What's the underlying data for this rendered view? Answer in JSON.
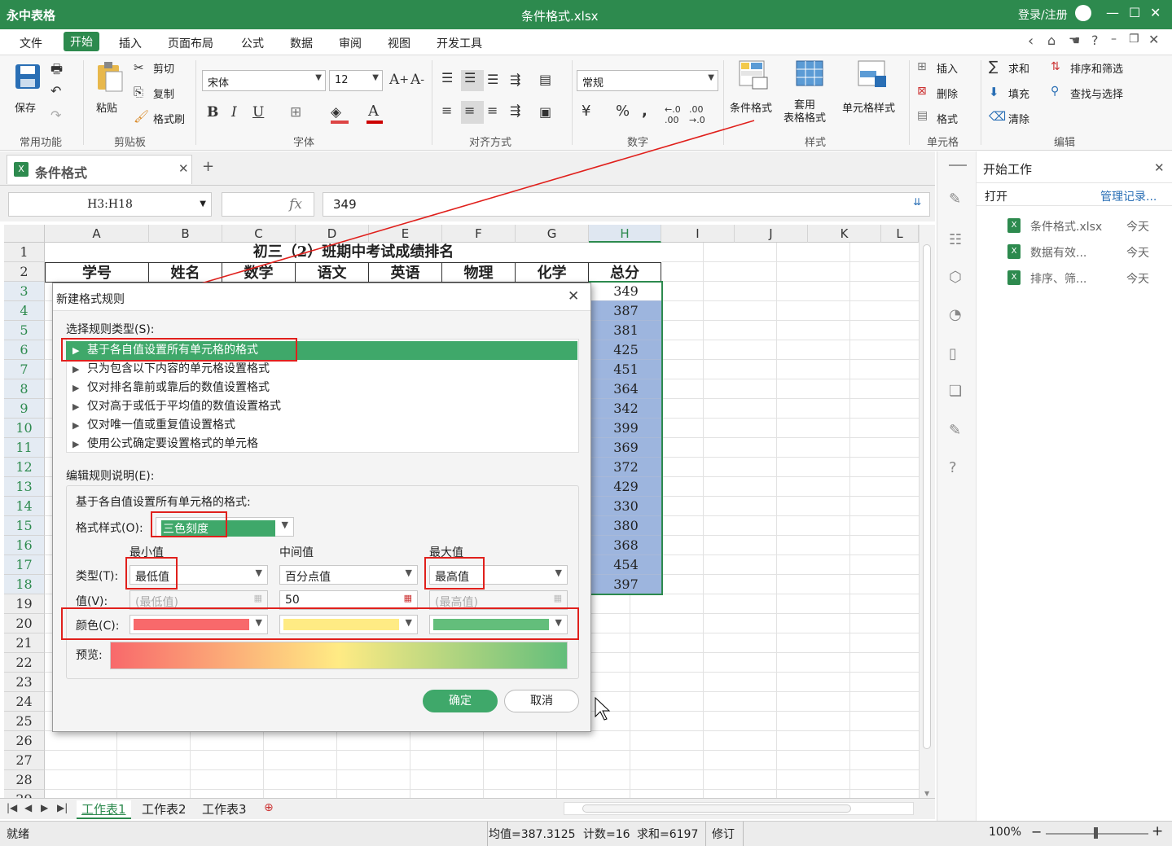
{
  "titlebar": {
    "app": "永中表格",
    "doc": "条件格式.xlsx",
    "login": "登录/注册"
  },
  "menus": [
    "文件",
    "开始",
    "插入",
    "页面布局",
    "公式",
    "数据",
    "审阅",
    "视图",
    "开发工具"
  ],
  "ribbon": {
    "save": "保存",
    "paste": "粘贴",
    "cut": "剪切",
    "copy": "复制",
    "format_painter": "格式刷",
    "font_name": "宋体",
    "font_size": "12",
    "number_format": "常规",
    "cond_format": "条件格式",
    "table_style": "套用\n表格格式",
    "cell_style": "单元格样式",
    "insert": "插入",
    "delete": "删除",
    "format": "格式",
    "sum": "求和",
    "fill": "填充",
    "clear": "清除",
    "sort_filter": "排序和筛选",
    "find_select": "查找与选择",
    "groups": [
      "常用功能",
      "剪贴板",
      "字体",
      "对齐方式",
      "数字",
      "样式",
      "单元格",
      "编辑"
    ]
  },
  "doc_tab": "条件格式",
  "formula": {
    "name_box": "H3:H18",
    "fx": "fx",
    "value": "349"
  },
  "columns": [
    "A",
    "B",
    "C",
    "D",
    "E",
    "F",
    "G",
    "H",
    "I",
    "J",
    "K"
  ],
  "rows": [
    "1",
    "2",
    "3",
    "4",
    "5",
    "6",
    "7",
    "8",
    "9",
    "10",
    "11",
    "12",
    "13",
    "14",
    "15",
    "16",
    "17",
    "18",
    "19",
    "20",
    "21",
    "22",
    "23",
    "24",
    "25",
    "26",
    "27",
    "28",
    "29"
  ],
  "sheet_title": "初三（2）班期中考试成绩排名",
  "headers": [
    "学号",
    "姓名",
    "数学",
    "语文",
    "英语",
    "物理",
    "化学",
    "总分"
  ],
  "totals": [
    "349",
    "387",
    "381",
    "425",
    "451",
    "364",
    "342",
    "399",
    "369",
    "372",
    "429",
    "330",
    "380",
    "368",
    "454",
    "397"
  ],
  "sheets": [
    "工作表1",
    "工作表2",
    "工作表3"
  ],
  "status": {
    "ready": "就绪",
    "avg": "均值=387.3125",
    "count": "计数=16",
    "sum": "求和=6197",
    "mode": "修订",
    "zoom": "100%"
  },
  "right_pane": {
    "title": "开始工作",
    "open": "打开",
    "manage": "管理记录...",
    "files": [
      {
        "name": "条件格式.xlsx",
        "date": "今天"
      },
      {
        "name": "数据有效...",
        "date": "今天"
      },
      {
        "name": "排序、筛...",
        "date": "今天"
      }
    ]
  },
  "dialog": {
    "title": "新建格式规则",
    "select_type_label": "选择规则类型(S):",
    "rules": [
      "基于各自值设置所有单元格的格式",
      "只为包含以下内容的单元格设置格式",
      "仅对排名靠前或靠后的数值设置格式",
      "仅对高于或低于平均值的数值设置格式",
      "仅对唯一值或重复值设置格式",
      "使用公式确定要设置格式的单元格"
    ],
    "edit_label": "编辑规则说明(E):",
    "desc": "基于各自值设置所有单元格的格式:",
    "style_label": "格式样式(O):",
    "style_value": "三色刻度",
    "min_label": "最小值",
    "mid_label": "中间值",
    "max_label": "最大值",
    "type_label": "类型(T):",
    "min_type": "最低值",
    "mid_type": "百分点值",
    "max_type": "最高值",
    "value_label": "值(V):",
    "min_value": "(最低值)",
    "mid_value": "50",
    "max_value": "(最高值)",
    "color_label": "颜色(C):",
    "preview_label": "预览:",
    "ok": "确定",
    "cancel": "取消",
    "colors": {
      "min": "#f8696b",
      "mid": "#ffeb84",
      "max": "#63be7b"
    }
  },
  "accent": "#2d8a4e"
}
